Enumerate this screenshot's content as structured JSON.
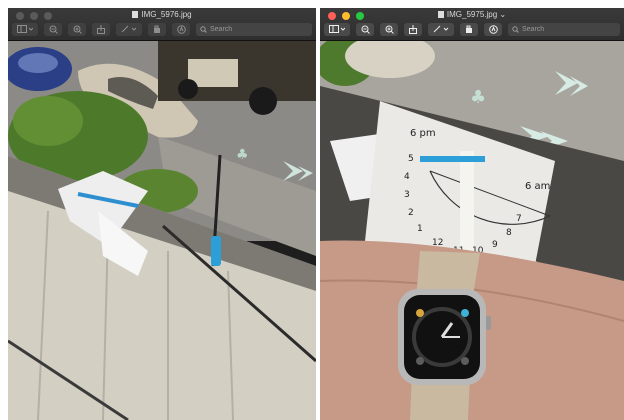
{
  "left_window": {
    "title": "IMG_5976.jpg",
    "search_placeholder": "Search",
    "icons": [
      "sidebar-icon",
      "zoom-out-icon",
      "zoom-in-icon",
      "share-icon",
      "markup-pen-icon",
      "rotate-icon",
      "annotate-icon"
    ]
  },
  "right_window": {
    "title": "IMG_5975.jpg ⌄",
    "search_placeholder": "Search",
    "icons": [
      "sidebar-icon",
      "zoom-out-icon",
      "zoom-in-icon",
      "share-icon",
      "markup-pen-icon",
      "rotate-icon",
      "annotate-icon"
    ]
  },
  "photo_right": {
    "dial_labels": [
      "6 pm",
      "6 am",
      "7",
      "8",
      "9",
      "10",
      "11",
      "12",
      "1",
      "2",
      "3",
      "4",
      "5"
    ]
  },
  "colors": {
    "titlebar": "#333333",
    "close": "#ff5f57",
    "minimize": "#febc2e",
    "zoom": "#28c840"
  }
}
